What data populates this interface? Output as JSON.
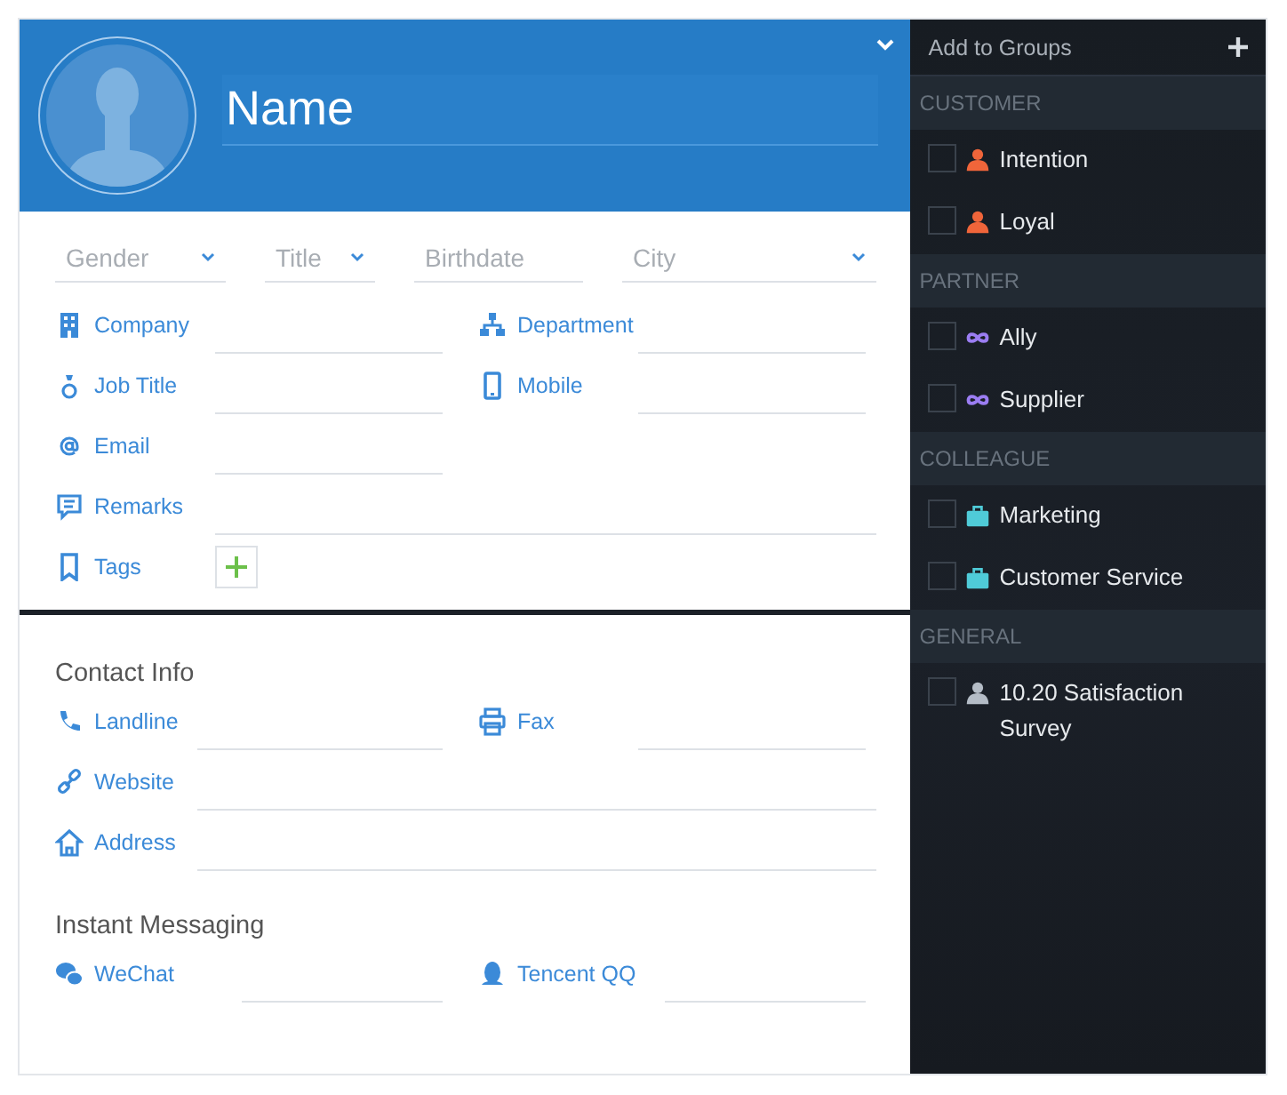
{
  "header": {
    "name_placeholder": "Name"
  },
  "basics": [
    {
      "placeholder": "Gender",
      "kind": "select"
    },
    {
      "placeholder": "Title",
      "kind": "select"
    },
    {
      "placeholder": "Birthdate",
      "kind": "date"
    },
    {
      "placeholder": "City",
      "kind": "select"
    }
  ],
  "details": [
    {
      "cells": [
        {
          "label": "Company",
          "kind": "building"
        },
        {
          "label": "Department",
          "kind": "org"
        }
      ]
    },
    {
      "cells": [
        {
          "label": "Job Title",
          "kind": "tie"
        },
        {
          "label": "Mobile",
          "kind": "phone"
        }
      ]
    },
    {
      "cells": [
        {
          "label": "Email",
          "kind": "at"
        }
      ]
    },
    {
      "cells": [
        {
          "label": "Remarks",
          "kind": "comment",
          "full": true
        }
      ]
    },
    {
      "cells": [
        {
          "label": "Tags",
          "kind": "tags"
        }
      ]
    }
  ],
  "contact": {
    "title": "Contact Info",
    "rows": [
      {
        "cells": [
          {
            "label": "Landline",
            "kind": "call"
          },
          {
            "label": "Fax",
            "kind": "printer"
          }
        ]
      },
      {
        "cells": [
          {
            "label": "Website",
            "kind": "link",
            "full": true
          }
        ]
      },
      {
        "cells": [
          {
            "label": "Address",
            "kind": "home",
            "full": true
          }
        ]
      }
    ]
  },
  "messaging": {
    "title": "Instant Messaging",
    "rows": [
      {
        "cells": [
          {
            "label": "WeChat",
            "kind": "chat"
          },
          {
            "label": "Tencent QQ",
            "kind": "penguin"
          }
        ]
      }
    ]
  },
  "groups_panel": {
    "title": "Add to Groups",
    "sections": [
      {
        "name": "CUSTOMER",
        "items": [
          {
            "label": "Intention",
            "kind": "person",
            "color": "#f0653a",
            "checked": false
          },
          {
            "label": "Loyal",
            "kind": "person",
            "color": "#f0653a",
            "checked": false
          }
        ]
      },
      {
        "name": "PARTNER",
        "items": [
          {
            "label": "Ally",
            "kind": "infinity",
            "color": "#9b7df2",
            "checked": false
          },
          {
            "label": "Supplier",
            "kind": "infinity",
            "color": "#9b7df2",
            "checked": false
          }
        ]
      },
      {
        "name": "COLLEAGUE",
        "items": [
          {
            "label": "Marketing",
            "kind": "briefcase",
            "color": "#4fcbd8",
            "checked": false
          },
          {
            "label": "Customer Service",
            "kind": "briefcase",
            "color": "#4fcbd8",
            "checked": false
          }
        ]
      },
      {
        "name": "GENERAL",
        "items": [
          {
            "label": "10.20 Satisfaction Survey",
            "kind": "person",
            "color": "#b4bcc6",
            "checked": false
          }
        ]
      }
    ]
  }
}
